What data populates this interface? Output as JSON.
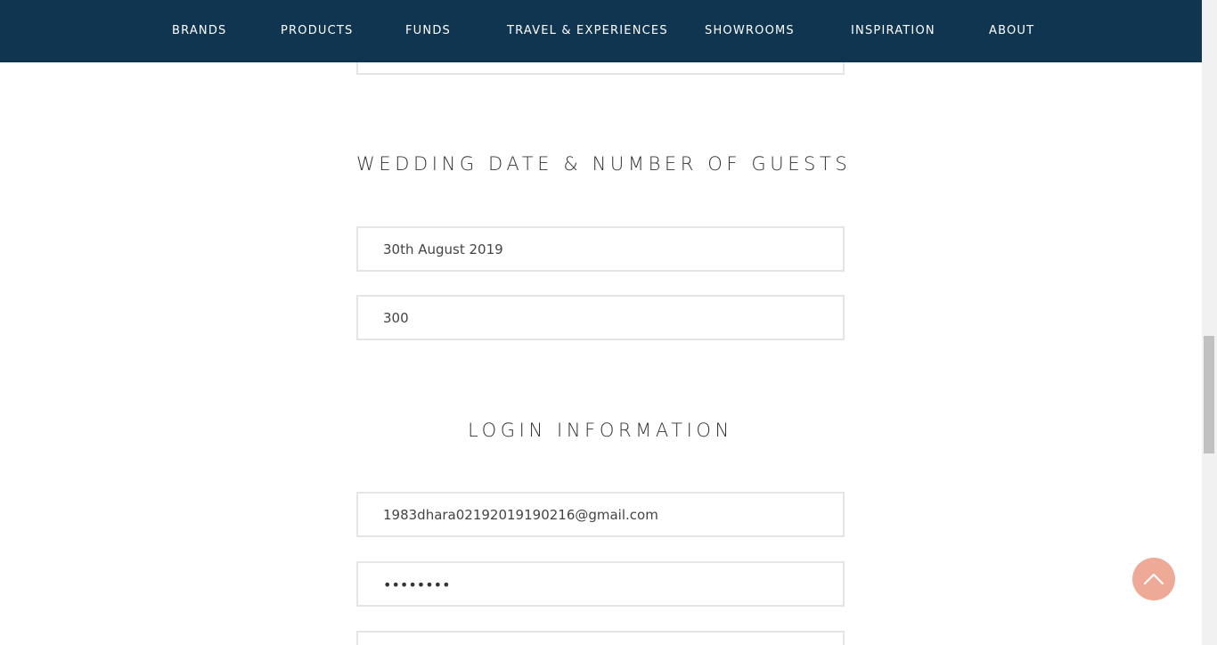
{
  "nav": {
    "items": [
      {
        "label": "BRANDS"
      },
      {
        "label": "PRODUCTS"
      },
      {
        "label": "FUNDS"
      },
      {
        "label": "TRAVEL & EXPERIENCES"
      },
      {
        "label": "SHOWROOMS"
      },
      {
        "label": "INSPIRATION"
      },
      {
        "label": "ABOUT"
      }
    ]
  },
  "sections": {
    "wedding": {
      "title": "WEDDING DATE & NUMBER OF GUESTS",
      "date_value": "30th August 2019",
      "guests_value": "300"
    },
    "login": {
      "title": "LOGIN INFORMATION",
      "email_value": "1983dhara02192019190216@gmail.com",
      "password_value": "••••••••"
    }
  },
  "colors": {
    "nav_background": "#0f3550",
    "back_to_top": "#eeaa96"
  },
  "icons": {
    "back_to_top": "chevron-up-icon"
  }
}
